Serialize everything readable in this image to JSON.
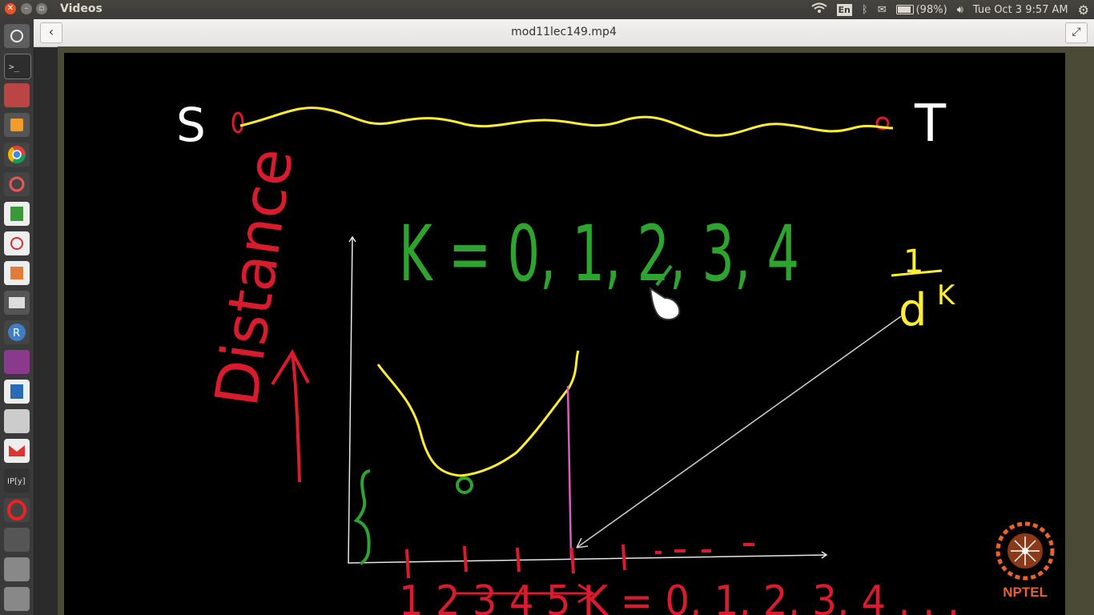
{
  "topbar": {
    "app_title": "Videos",
    "language": "En",
    "battery": "(98%)",
    "datetime": "Tue Oct  3  9:57 AM"
  },
  "headerbar": {
    "file_title": "mod11lec149.mp4",
    "back_label": "‹",
    "fullscreen_label": "⤢"
  },
  "launcher": {
    "items": [
      "dash",
      "terminal",
      "files",
      "sublime-text",
      "chrome",
      "settings",
      "spreadsheet",
      "document-viewer",
      "presentation",
      "video-editor",
      "r-studio",
      "media-player",
      "writer",
      "text-editor",
      "gmail",
      "ipython",
      "opera",
      "gimp",
      "drive",
      "drive"
    ]
  },
  "video": {
    "handwriting": {
      "source": "S",
      "target": "T",
      "k_values_top": "K = 0, 1, 2, 3, 4",
      "y_axis_label": "Distance",
      "fraction_numerator": "1",
      "fraction_denominator": "d",
      "fraction_exponent": "K",
      "bottom_labels": "1  2  3  4  5  K = 0, 1, 2, 3, 4 . . ."
    },
    "logo_text": "NPTEL"
  },
  "colors": {
    "curve": "#ffee33",
    "annotation_red": "#d81c2e",
    "annotation_green": "#2fa32f",
    "pink_line": "#d95fbf"
  }
}
